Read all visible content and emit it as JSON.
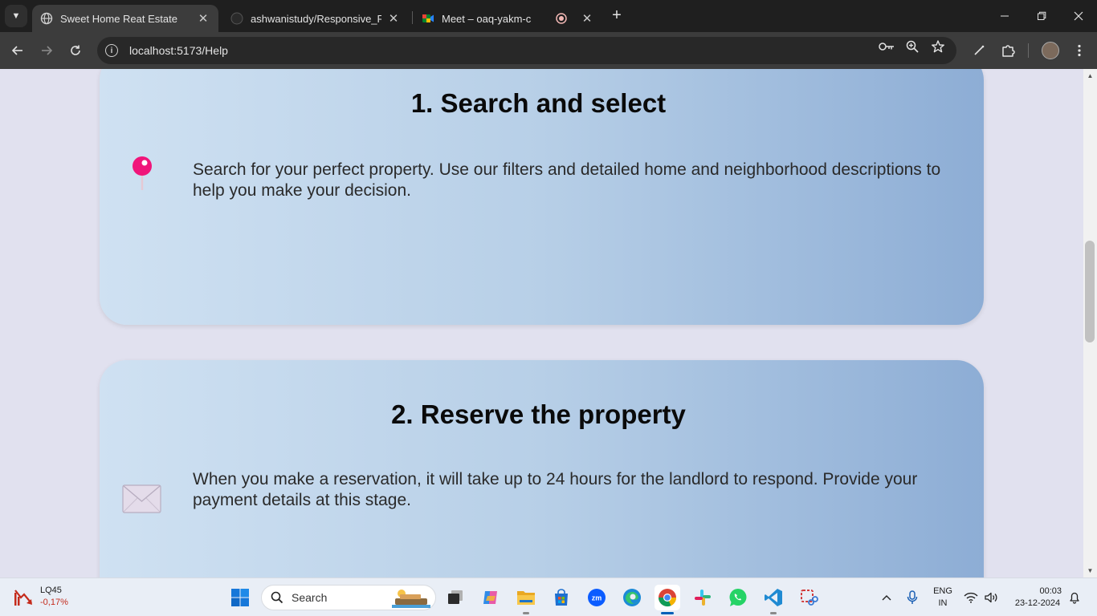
{
  "browser": {
    "tabs": [
      {
        "title": "Sweet Home Reat Estate",
        "icon": "globe-icon",
        "active": true
      },
      {
        "title": "ashwanistudy/Responsive_Rider",
        "icon": "github-icon",
        "active": false
      },
      {
        "title": "Meet – oaq-yakm-cmi",
        "icon": "google-meet-icon",
        "active": false
      }
    ],
    "url": "localhost:5173/Help"
  },
  "page": {
    "steps": [
      {
        "heading": "1. Search and select",
        "text": "Search for your perfect property. Use our filters and detailed home and neighborhood descriptions to help you make your decision.",
        "icon": "pushpin-icon"
      },
      {
        "heading": "2. Reserve the property",
        "text": "When you make a reservation, it will take up to 24 hours for the landlord to respond. Provide your payment details at this stage.",
        "icon": "envelope-icon"
      }
    ]
  },
  "taskbar": {
    "stock_ticker": "LQ45",
    "stock_change": "-0,17%",
    "search_label": "Search",
    "language_line1": "ENG",
    "language_line2": "IN",
    "time": "00:03",
    "date": "23-12-2024"
  },
  "colors": {
    "accent": "#005fb8",
    "pin_head": "#f0157a",
    "stock_negative": "#c42b1c"
  }
}
